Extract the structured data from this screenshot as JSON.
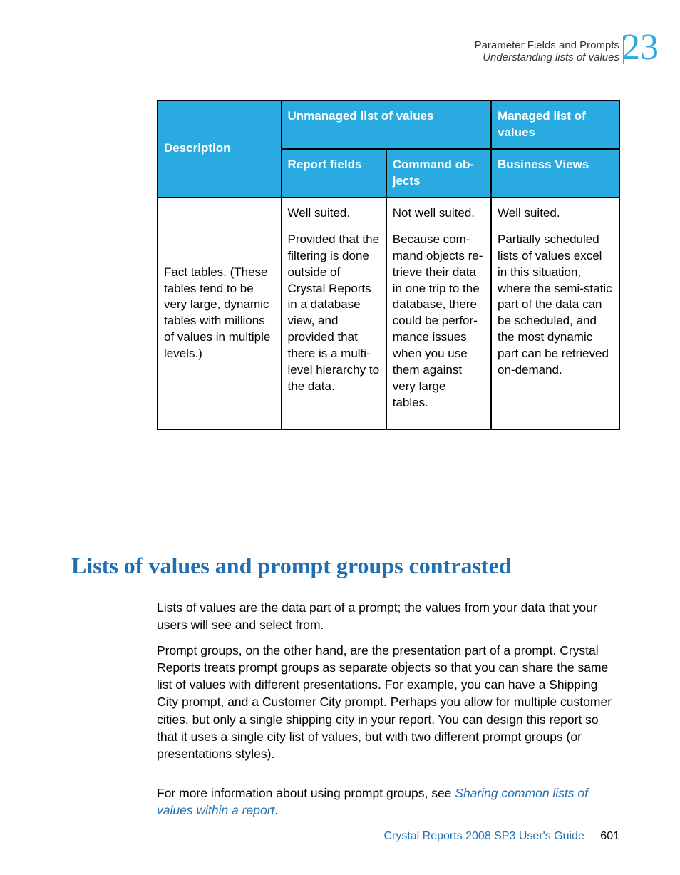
{
  "header": {
    "title": "Parameter Fields and Prompts",
    "subtitle": "Understanding lists of values",
    "chapter_num": "23"
  },
  "table": {
    "th_description": "Description",
    "th_unmanaged": "Unmanaged list of values",
    "th_managed": "Managed list of values",
    "th_report_fields": "Report fields",
    "th_command_objects": "Command ob­jects",
    "th_business_views": "Business Views",
    "row1": {
      "desc": "Fact tables. (These tables tend to be very large, dynamic ta­bles with millions of values in multi­ple levels.)",
      "rf_p1": "Well suited.",
      "rf_p2": "Provided that the filtering is done outside of Crystal Reports in a database view, and provided that there is a multi-level hierarchy to the data.",
      "co_p1": "Not well suited.",
      "co_p2": "Because com­mand objects re­trieve their data in one trip to the database, there could be perfor­mance issues when you use them against very large tables.",
      "bv_p1": "Well suited.",
      "bv_p2": "Partially sched­uled lists of val­ues excel in this situation, where the semi-static part of the data can be sched­uled, and the most dynamic part can be re­trieved on-de­mand."
    }
  },
  "section_title": "Lists of values and prompt groups contrasted",
  "paragraphs": {
    "p1": "Lists of values are the data part of a prompt; the values from your data that your users will see and select from.",
    "p2": "Prompt groups, on the other hand, are the presentation part of a prompt. Crystal Reports treats prompt groups as separate objects so that you can share the same list of values with different presentations. For example, you can have a Shipping City prompt, and a Customer City prompt. Perhaps you allow for multiple customer cities, but only a single shipping city in your report. You can design this report so that it uses a single city list of values, but with two different prompt groups (or presentations styles).",
    "p3_prefix": "For more information about using prompt groups, see ",
    "p3_link": "Sharing common lists of values within a report",
    "p3_suffix": "."
  },
  "footer": {
    "guide": "Crystal Reports 2008 SP3 User's Guide",
    "page": "601"
  }
}
